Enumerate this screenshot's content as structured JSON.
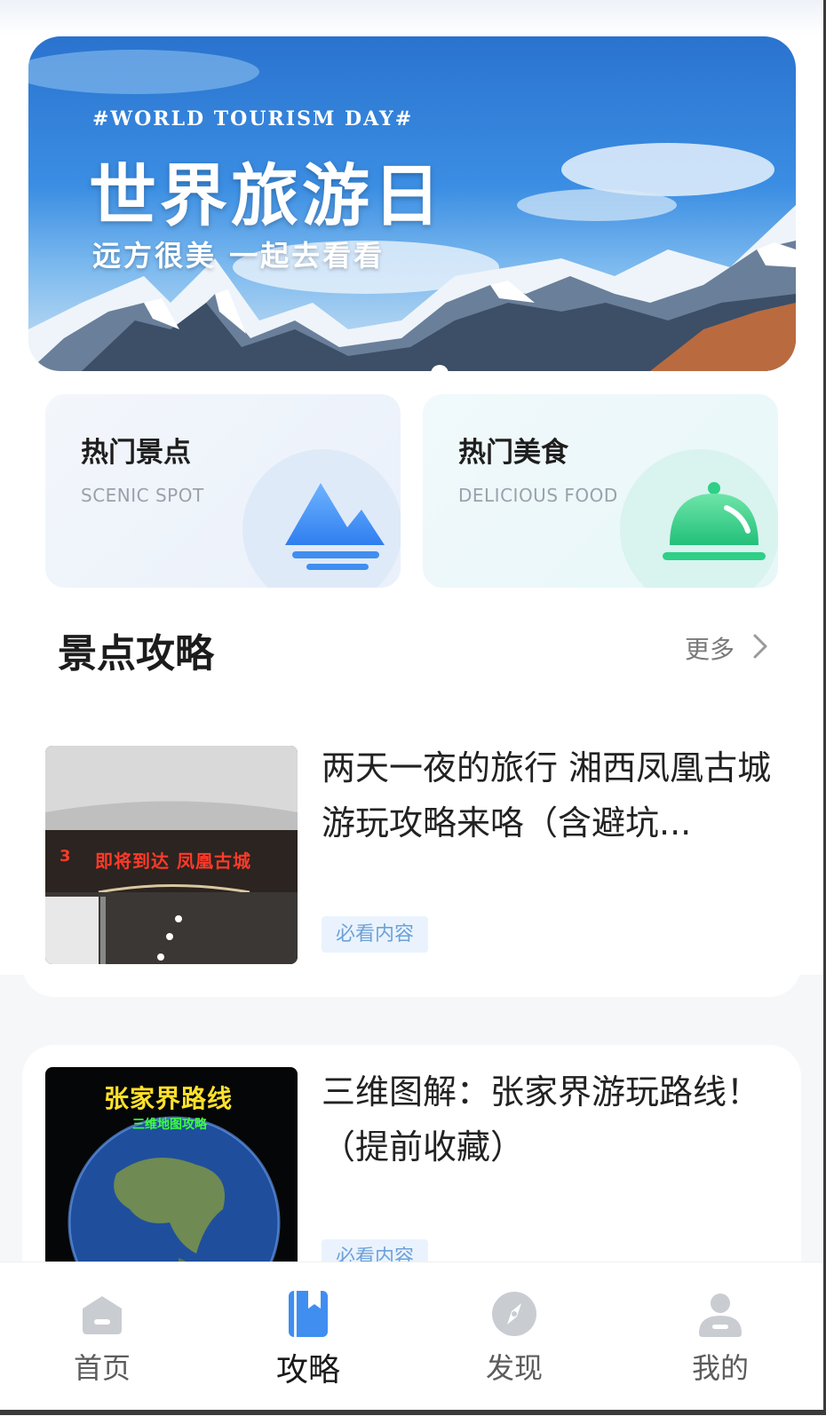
{
  "banner": {
    "tag": "#WORLD TOURISM DAY#",
    "title": "世界旅游日",
    "subtitle": "远方很美  一起去看看"
  },
  "categories": [
    {
      "title": "热门景点",
      "subtitle": "SCENIC SPOT",
      "icon": "mountain-icon"
    },
    {
      "title": "热门美食",
      "subtitle": "DELICIOUS FOOD",
      "icon": "food-cloche-icon"
    }
  ],
  "section": {
    "title": "景点攻略",
    "more": "更多"
  },
  "articles": [
    {
      "title": "两天一夜的旅行 湘西凤凰古城游玩攻略来咯（含避坑...",
      "tag": "必看内容",
      "thumb_text": "即将到达 凤凰古城",
      "thumb_num": "3"
    },
    {
      "title": "三维图解：张家界游玩路线！（提前收藏）",
      "tag": "必看内容",
      "thumb_text": "张家界路线",
      "thumb_sub": "三维地图攻略"
    }
  ],
  "nav": [
    {
      "label": "首页",
      "icon": "home-icon",
      "active": false
    },
    {
      "label": "攻略",
      "icon": "guide-book-icon",
      "active": true
    },
    {
      "label": "发现",
      "icon": "compass-icon",
      "active": false
    },
    {
      "label": "我的",
      "icon": "profile-icon",
      "active": false
    }
  ],
  "colors": {
    "accent": "#3f8ef0",
    "tag_bg": "#eaf3fd",
    "tag_text": "#6ea1d8"
  }
}
